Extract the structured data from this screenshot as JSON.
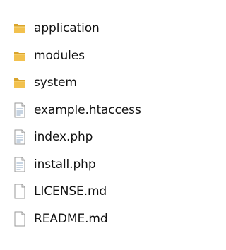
{
  "files": [
    {
      "name": "application",
      "icon": "folder-icon"
    },
    {
      "name": "modules",
      "icon": "folder-icon"
    },
    {
      "name": "system",
      "icon": "folder-icon"
    },
    {
      "name": "example.htaccess",
      "icon": "document-text-icon"
    },
    {
      "name": "index.php",
      "icon": "document-text-icon"
    },
    {
      "name": "install.php",
      "icon": "document-text-icon"
    },
    {
      "name": "LICENSE.md",
      "icon": "document-blank-icon"
    },
    {
      "name": "README.md",
      "icon": "document-blank-icon"
    }
  ],
  "colors": {
    "folder_front": "#f2c14e",
    "folder_back": "#d9a42c",
    "document_border": "#9a9a9a",
    "document_lines": "#8fa8c4",
    "text": "#111111"
  }
}
